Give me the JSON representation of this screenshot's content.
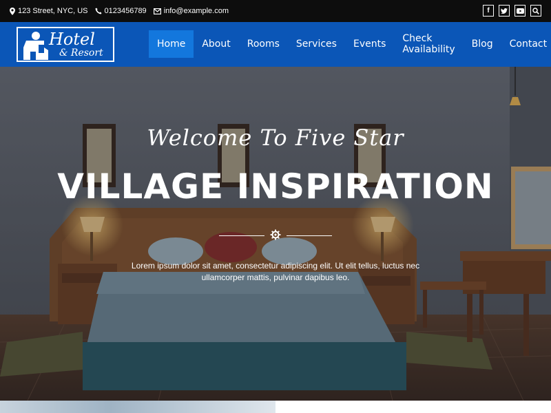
{
  "topbar": {
    "address": "123 Street, NYC, US",
    "phone": "0123456789",
    "email": "info@example.com",
    "social_icons": [
      "facebook-icon",
      "twitter-icon",
      "youtube-icon",
      "search-icon"
    ]
  },
  "header": {
    "logo_line1": "Hotel",
    "logo_line2": "& Resort",
    "nav": [
      {
        "label": "Home",
        "active": true
      },
      {
        "label": "About"
      },
      {
        "label": "Rooms"
      },
      {
        "label": "Services"
      },
      {
        "label": "Events"
      },
      {
        "label": "Check Availability"
      },
      {
        "label": "Blog"
      },
      {
        "label": "Contact"
      }
    ]
  },
  "hero": {
    "subtitle": "Welcome To Five Star",
    "title": "VILLAGE INSPIRATION",
    "description": "Lorem ipsum dolor sit amet, consectetur adipiscing elit. Ut elit tellus, luctus nec ullamcorper mattis, pulvinar dapibus leo."
  },
  "colors": {
    "topbar": "#0d0d0d",
    "header": "#0b56b7",
    "nav_active": "#1377dd"
  }
}
